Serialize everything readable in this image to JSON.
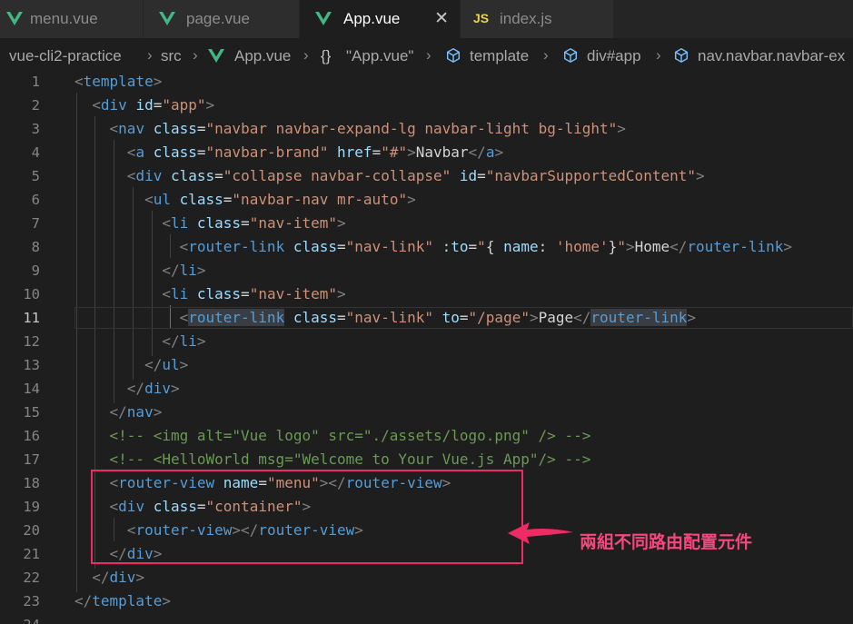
{
  "tabs": [
    {
      "label": "menu.vue",
      "icon": "vue-icon"
    },
    {
      "label": "page.vue",
      "icon": "vue-icon"
    },
    {
      "label": "App.vue",
      "icon": "vue-icon",
      "close": "✕"
    },
    {
      "label": "index.js",
      "icon_text": "JS"
    }
  ],
  "breadcrumb": {
    "project": "vue-cli2-practice",
    "folder": "src",
    "file": "App.vue",
    "obj_icon": "{}",
    "obj": "\"App.vue\"",
    "template": "template",
    "div": "div#app",
    "nav": "nav.navbar.navbar-ex"
  },
  "code": {
    "line_numbers": [
      "1",
      "2",
      "3",
      "4",
      "5",
      "6",
      "7",
      "8",
      "9",
      "10",
      "11",
      "12",
      "13",
      "14",
      "15",
      "16",
      "17",
      "18",
      "19",
      "20",
      "21",
      "22",
      "23",
      "24"
    ],
    "current_line": "11"
  },
  "annotation": {
    "text": "兩組不同路由配置元件",
    "color": "#f02a64"
  },
  "colors": {
    "tag": "#569cd6",
    "attr": "#9cdcfe",
    "string": "#ce9178",
    "comment": "#6a9955",
    "vue_green": "#41b883"
  }
}
